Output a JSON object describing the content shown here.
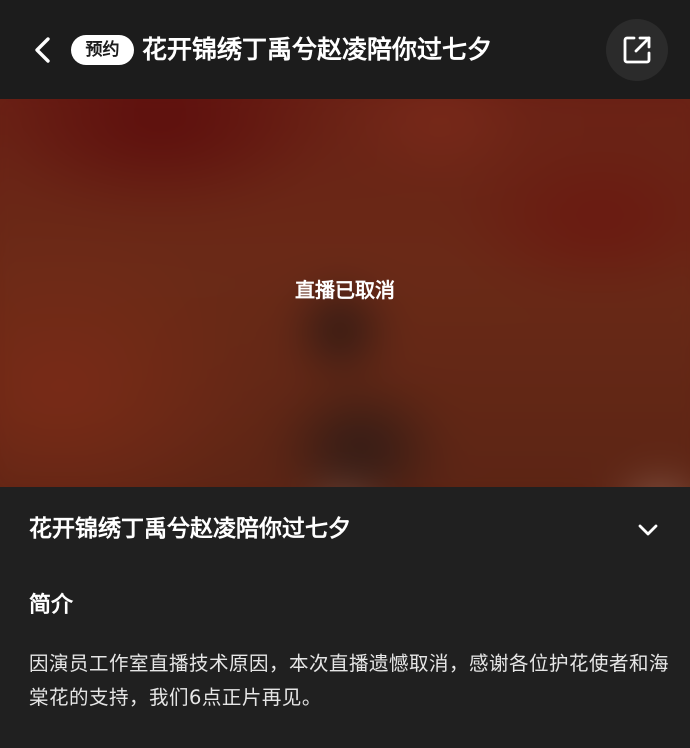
{
  "header": {
    "back_icon": "chevron-left-icon",
    "badge": "预约",
    "title": "花开锦绣丁禹兮赵凌陪你过七夕",
    "share_icon": "share-external-icon"
  },
  "player": {
    "status": "直播已取消"
  },
  "info": {
    "title": "花开锦绣丁禹兮赵凌陪你过七夕",
    "expand_icon": "chevron-down-icon",
    "section_heading": "简介",
    "description": "因演员工作室直播技术原因，本次直播遗憾取消，感谢各位护花使者和海棠花的支持，我们6点正片再见。"
  },
  "colors": {
    "background": "#202020",
    "header_bg": "#1c1c1c",
    "badge_bg": "#ffffff",
    "text": "#ffffff"
  }
}
